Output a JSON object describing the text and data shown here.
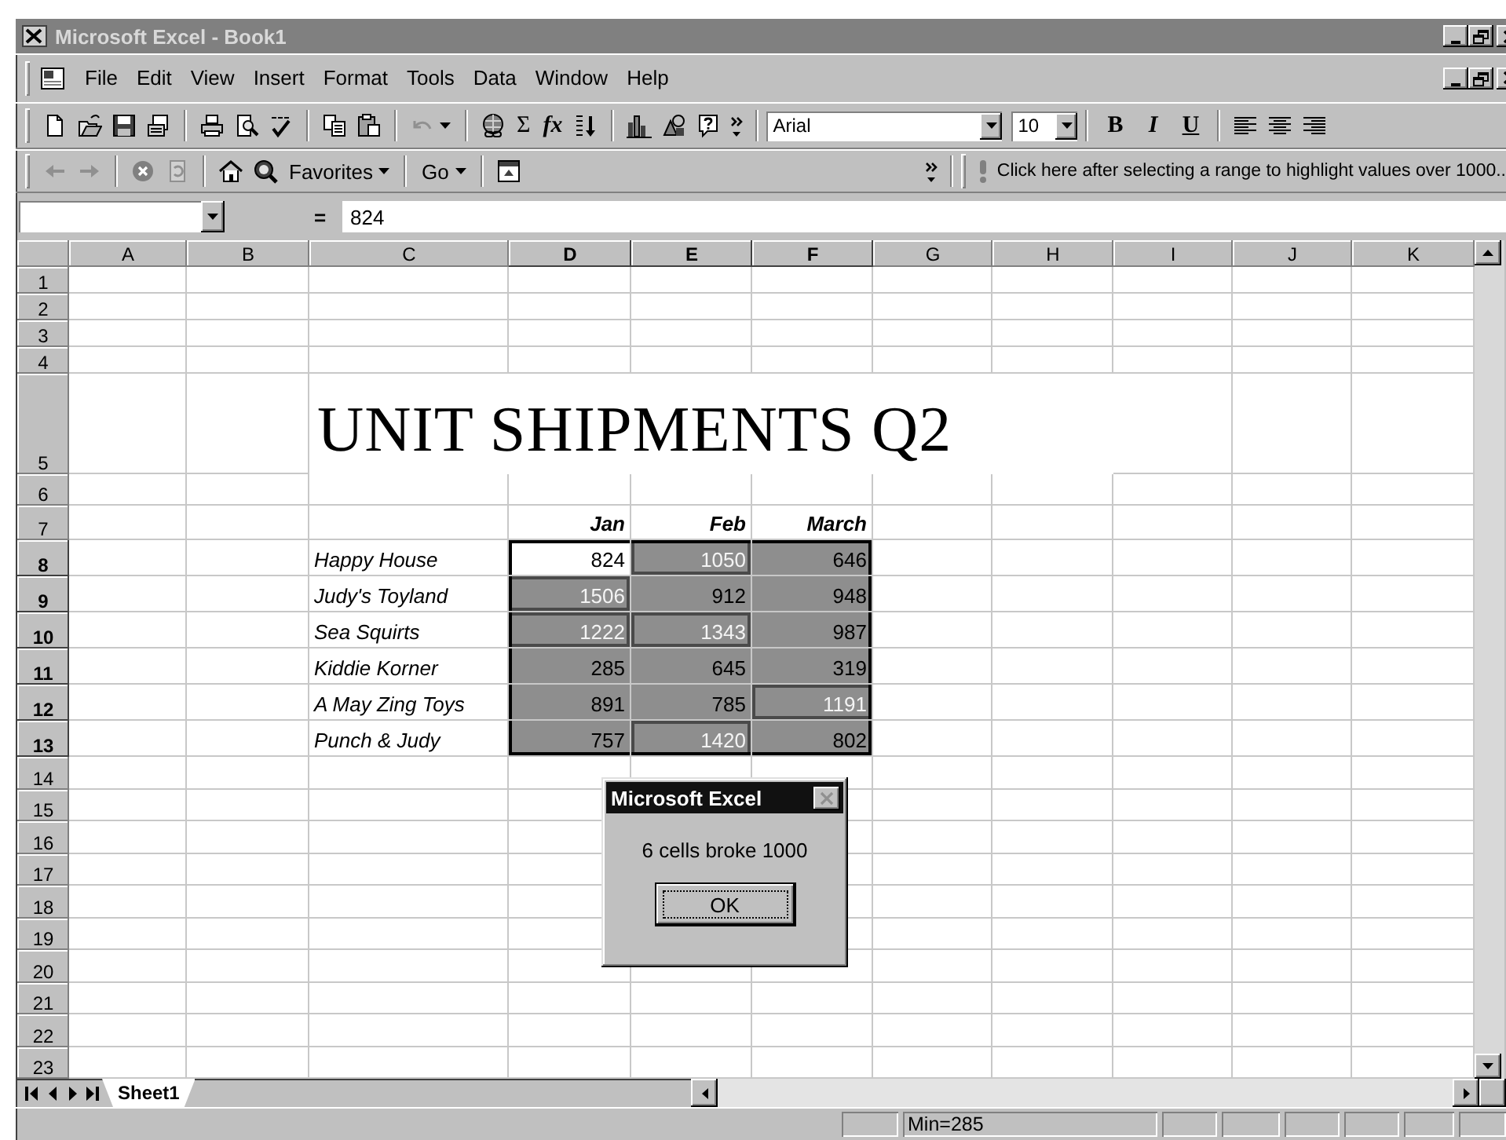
{
  "window": {
    "title": "Microsoft Excel - Book1"
  },
  "menu": [
    "File",
    "Edit",
    "View",
    "Insert",
    "Format",
    "Tools",
    "Data",
    "Window",
    "Help"
  ],
  "standard_toolbar": {
    "sum": "Σ",
    "function": "fx"
  },
  "formatting_toolbar": {
    "font": "Arial",
    "size": "10",
    "style_buttons": [
      "B",
      "I",
      "U"
    ]
  },
  "web_toolbar": {
    "favorites": "Favorites",
    "go": "Go",
    "hint": "Click here after selecting a range to highlight values over 1000.."
  },
  "formula_bar": {
    "equals": "=",
    "value": "824"
  },
  "sheet": {
    "columns": [
      {
        "label": "A",
        "selected": false
      },
      {
        "label": "B",
        "selected": false
      },
      {
        "label": "C",
        "selected": false
      },
      {
        "label": "D",
        "selected": true
      },
      {
        "label": "E",
        "selected": true
      },
      {
        "label": "F",
        "selected": true
      },
      {
        "label": "G",
        "selected": false
      },
      {
        "label": "H",
        "selected": false
      },
      {
        "label": "I",
        "selected": false
      },
      {
        "label": "J",
        "selected": false
      },
      {
        "label": "K",
        "selected": false
      }
    ],
    "rows": [
      {
        "label": "1",
        "selected": false
      },
      {
        "label": "2",
        "selected": false
      },
      {
        "label": "3",
        "selected": false
      },
      {
        "label": "4",
        "selected": false
      },
      {
        "label": "5",
        "selected": false
      },
      {
        "label": "6",
        "selected": false
      },
      {
        "label": "7",
        "selected": false
      },
      {
        "label": "8",
        "selected": true
      },
      {
        "label": "9",
        "selected": true
      },
      {
        "label": "10",
        "selected": true
      },
      {
        "label": "11",
        "selected": true
      },
      {
        "label": "12",
        "selected": true
      },
      {
        "label": "13",
        "selected": true
      },
      {
        "label": "14",
        "selected": false
      },
      {
        "label": "15",
        "selected": false
      },
      {
        "label": "16",
        "selected": false
      },
      {
        "label": "17",
        "selected": false
      },
      {
        "label": "18",
        "selected": false
      },
      {
        "label": "19",
        "selected": false
      },
      {
        "label": "20",
        "selected": false
      },
      {
        "label": "21",
        "selected": false
      },
      {
        "label": "22",
        "selected": false
      },
      {
        "label": "23",
        "selected": false
      }
    ],
    "title": "UNIT SHIPMENTS Q2",
    "headers": [
      "Jan",
      "Feb",
      "March"
    ],
    "data": [
      {
        "name": "Happy House",
        "values": [
          {
            "text": "824",
            "selected": true,
            "active": true,
            "over": false
          },
          {
            "text": "1050",
            "selected": true,
            "active": false,
            "over": true
          },
          {
            "text": "646",
            "selected": true,
            "active": false,
            "over": false
          }
        ]
      },
      {
        "name": "Judy's Toyland",
        "values": [
          {
            "text": "1506",
            "selected": true,
            "active": false,
            "over": true
          },
          {
            "text": "912",
            "selected": true,
            "active": false,
            "over": false
          },
          {
            "text": "948",
            "selected": true,
            "active": false,
            "over": false
          }
        ]
      },
      {
        "name": "Sea Squirts",
        "values": [
          {
            "text": "1222",
            "selected": true,
            "active": false,
            "over": true
          },
          {
            "text": "1343",
            "selected": true,
            "active": false,
            "over": true
          },
          {
            "text": "987",
            "selected": true,
            "active": false,
            "over": false
          }
        ]
      },
      {
        "name": "Kiddie Korner",
        "values": [
          {
            "text": "285",
            "selected": true,
            "active": false,
            "over": false
          },
          {
            "text": "645",
            "selected": true,
            "active": false,
            "over": false
          },
          {
            "text": "319",
            "selected": true,
            "active": false,
            "over": false
          }
        ]
      },
      {
        "name": "A May Zing Toys",
        "values": [
          {
            "text": "891",
            "selected": true,
            "active": false,
            "over": false
          },
          {
            "text": "785",
            "selected": true,
            "active": false,
            "over": false
          },
          {
            "text": "1191",
            "selected": true,
            "active": false,
            "over": true
          }
        ]
      },
      {
        "name": "Punch & Judy",
        "values": [
          {
            "text": "757",
            "selected": true,
            "active": false,
            "over": false
          },
          {
            "text": "1420",
            "selected": true,
            "active": false,
            "over": true
          },
          {
            "text": "802",
            "selected": true,
            "active": false,
            "over": false
          }
        ]
      }
    ]
  },
  "sheet_tabs": [
    {
      "label": "Sheet1",
      "selected": true
    }
  ],
  "status_bar": {
    "reading": "Min=285"
  },
  "dialog": {
    "title": "Microsoft Excel",
    "message": "6 cells broke 1000",
    "button": "OK"
  }
}
